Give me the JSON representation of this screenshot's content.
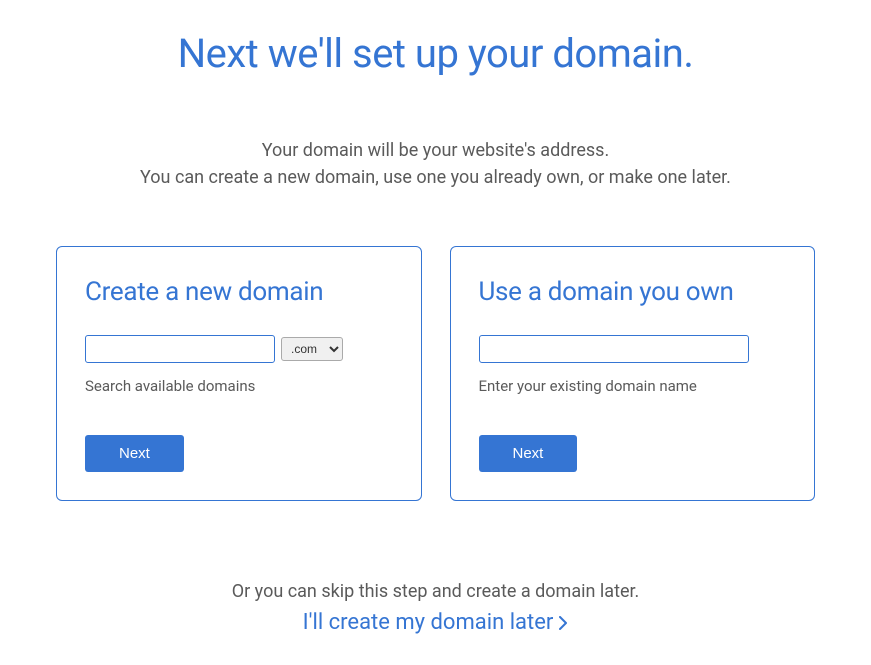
{
  "header": {
    "title": "Next we'll set up your domain.",
    "subtitle_line1": "Your domain will be your website's address.",
    "subtitle_line2": "You can create a new domain, use one you already own, or make one later."
  },
  "create_card": {
    "title": "Create a new domain",
    "input_value": "",
    "tld_selected": ".com",
    "helper": "Search available domains",
    "button": "Next"
  },
  "own_card": {
    "title": "Use a domain you own",
    "input_value": "",
    "helper": "Enter your existing domain name",
    "button": "Next"
  },
  "skip": {
    "text": "Or you can skip this step and create a domain later.",
    "link": "I'll create my domain later"
  },
  "colors": {
    "primary": "#3575d3",
    "text_muted": "#5a5a5a"
  }
}
